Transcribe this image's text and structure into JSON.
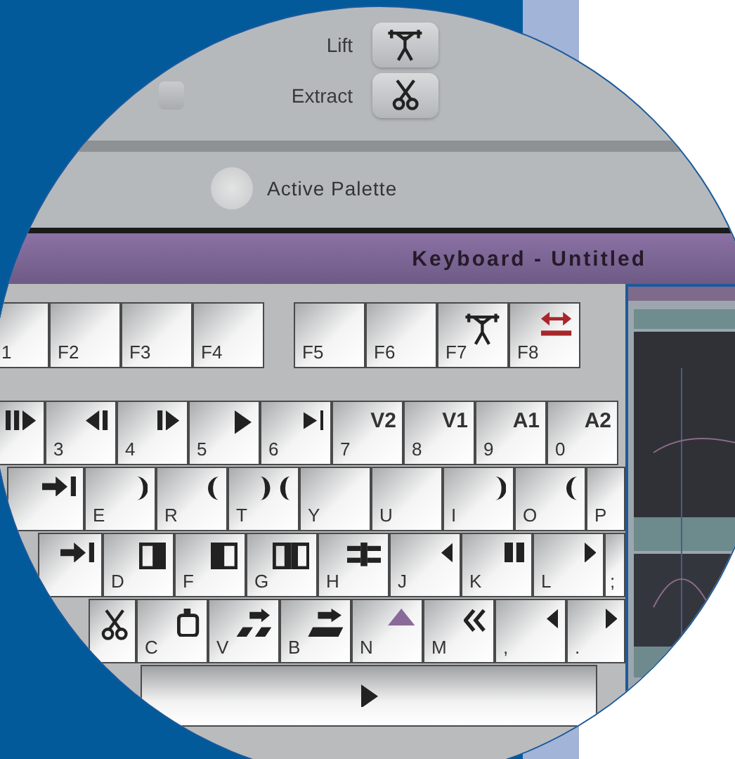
{
  "top_panel": {
    "buttons": [
      {
        "label": "Lift"
      },
      {
        "label": "Extract"
      }
    ],
    "active_palette": {
      "label": "Active Palette",
      "checked": false
    }
  },
  "keyboard_window": {
    "title": "Keyboard - Untitled",
    "function_keys": [
      [
        {
          "label": "1"
        },
        {
          "label": "F2"
        },
        {
          "label": "F3"
        },
        {
          "label": "F4"
        }
      ],
      [
        {
          "label": "F5"
        },
        {
          "label": "F6"
        },
        {
          "label": "F7"
        },
        {
          "label": "F8"
        }
      ]
    ],
    "rows": [
      [
        {
          "label": "3"
        },
        {
          "label": "4"
        },
        {
          "label": "5"
        },
        {
          "label": "6"
        },
        {
          "label": "7",
          "cap": "V2"
        },
        {
          "label": "8",
          "cap": "V1"
        },
        {
          "label": "9",
          "cap": "A1"
        },
        {
          "label": "0",
          "cap": "A2"
        }
      ],
      [
        {
          "label": "E"
        },
        {
          "label": "R"
        },
        {
          "label": "T"
        },
        {
          "label": "Y"
        },
        {
          "label": "U"
        },
        {
          "label": "I"
        },
        {
          "label": "O"
        },
        {
          "label": "P"
        }
      ],
      [
        {
          "label": "D"
        },
        {
          "label": "F"
        },
        {
          "label": "G"
        },
        {
          "label": "H"
        },
        {
          "label": "J"
        },
        {
          "label": "K"
        },
        {
          "label": "L"
        },
        {
          "label": ";"
        }
      ],
      [
        {
          "label": "C"
        },
        {
          "label": "V"
        },
        {
          "label": "B"
        },
        {
          "label": "N"
        },
        {
          "label": "M"
        },
        {
          "label": ","
        },
        {
          "label": "."
        }
      ]
    ]
  }
}
